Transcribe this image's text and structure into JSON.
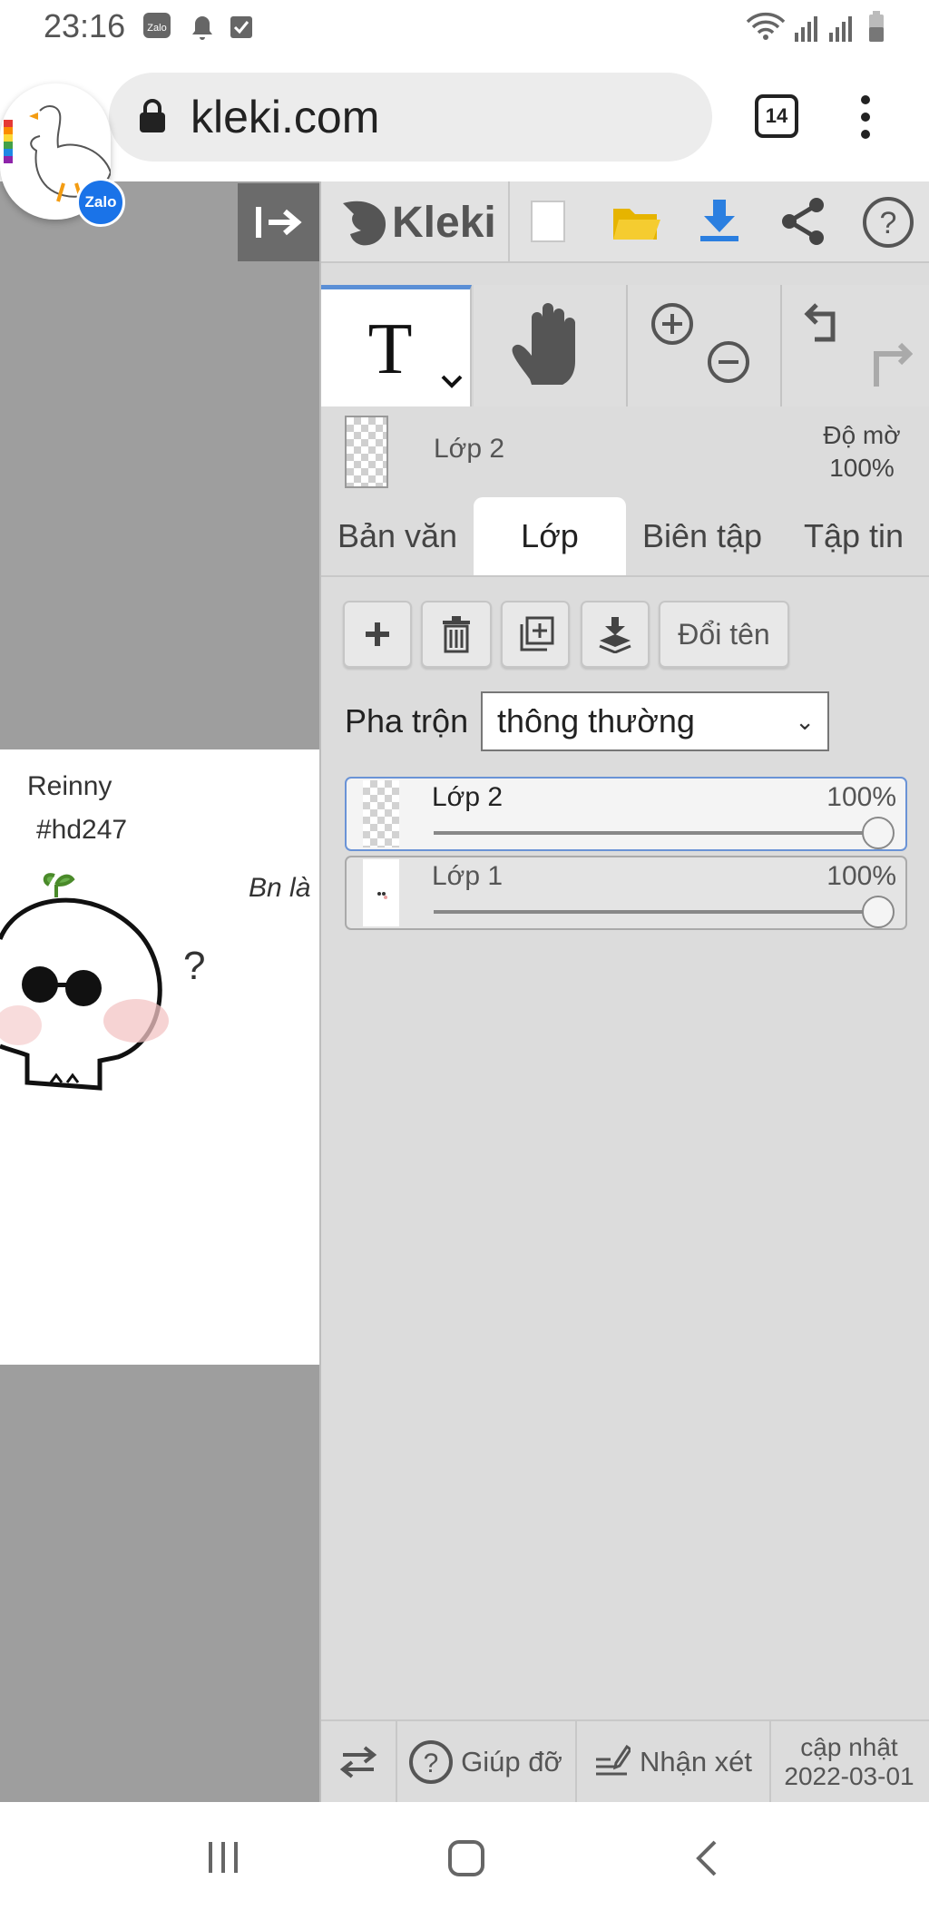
{
  "status_bar": {
    "time": "23:16"
  },
  "browser": {
    "url": "kleki.com",
    "tab_count": "14",
    "floating_chat_label": "Zalo"
  },
  "canvas": {
    "texts": [
      "Reinny",
      "#hd247",
      "Bn là",
      "?"
    ]
  },
  "app": {
    "name": "Kleki",
    "active_layer_name": "Lớp 2",
    "opacity_label": "Độ mờ",
    "opacity_value": "100%",
    "tabs": [
      "Bản văn",
      "Lớp",
      "Biên tập",
      "Tập tin"
    ],
    "active_tab": "Lớp",
    "rename_label": "Đổi tên",
    "blend_label": "Pha trộn",
    "blend_value": "thông thường",
    "layers": [
      {
        "name": "Lớp 2",
        "opacity": "100%",
        "selected": true
      },
      {
        "name": "Lớp 1",
        "opacity": "100%",
        "selected": false
      }
    ],
    "footer": {
      "help_label": "Giúp đỡ",
      "feedback_label": "Nhận xét",
      "update_label": "cập nhật",
      "update_date": "2022-03-01"
    },
    "accent_color": "#2b7fe0",
    "icons": [
      "collapse-panel-icon",
      "text-tool-icon",
      "hand-tool-icon",
      "zoom-in-icon",
      "zoom-out-icon",
      "undo-icon",
      "redo-icon",
      "new-image-icon",
      "open-folder-icon",
      "download-icon",
      "share-icon",
      "help-icon",
      "add-layer-icon",
      "delete-layer-icon",
      "duplicate-layer-icon",
      "merge-layer-icon",
      "swap-side-icon",
      "feedback-icon"
    ]
  }
}
